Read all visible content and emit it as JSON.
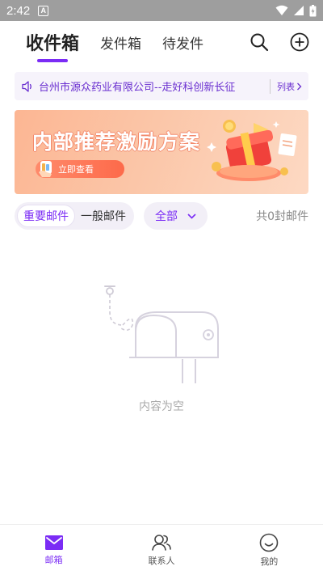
{
  "status_bar": {
    "time": "2:42",
    "notification_badge": "A"
  },
  "header": {
    "tabs": [
      {
        "label": "收件箱",
        "active": true
      },
      {
        "label": "发件箱",
        "active": false
      },
      {
        "label": "待发件",
        "active": false
      }
    ],
    "icons": [
      "search-icon",
      "add-circle-icon"
    ]
  },
  "notice": {
    "text": "台州市源众药业有限公司--走好科创新长征",
    "list_label": "列表"
  },
  "banner": {
    "title": "内部推荐激励方案",
    "button_label": "立即查看"
  },
  "filter": {
    "segments": [
      {
        "label": "重要邮件",
        "active": true
      },
      {
        "label": "一般邮件",
        "active": false
      }
    ],
    "dropdown_label": "全部",
    "count_text": "共0封邮件"
  },
  "empty_state": {
    "text": "内容为空"
  },
  "bottom_nav": {
    "items": [
      {
        "label": "邮箱",
        "icon": "mail-icon",
        "active": true
      },
      {
        "label": "联系人",
        "icon": "contacts-icon",
        "active": false
      },
      {
        "label": "我的",
        "icon": "profile-icon",
        "active": false
      }
    ]
  },
  "colors": {
    "accent": "#7b2cf5",
    "status_bar": "#9e9e9e",
    "banner": "#fbc6a8"
  }
}
